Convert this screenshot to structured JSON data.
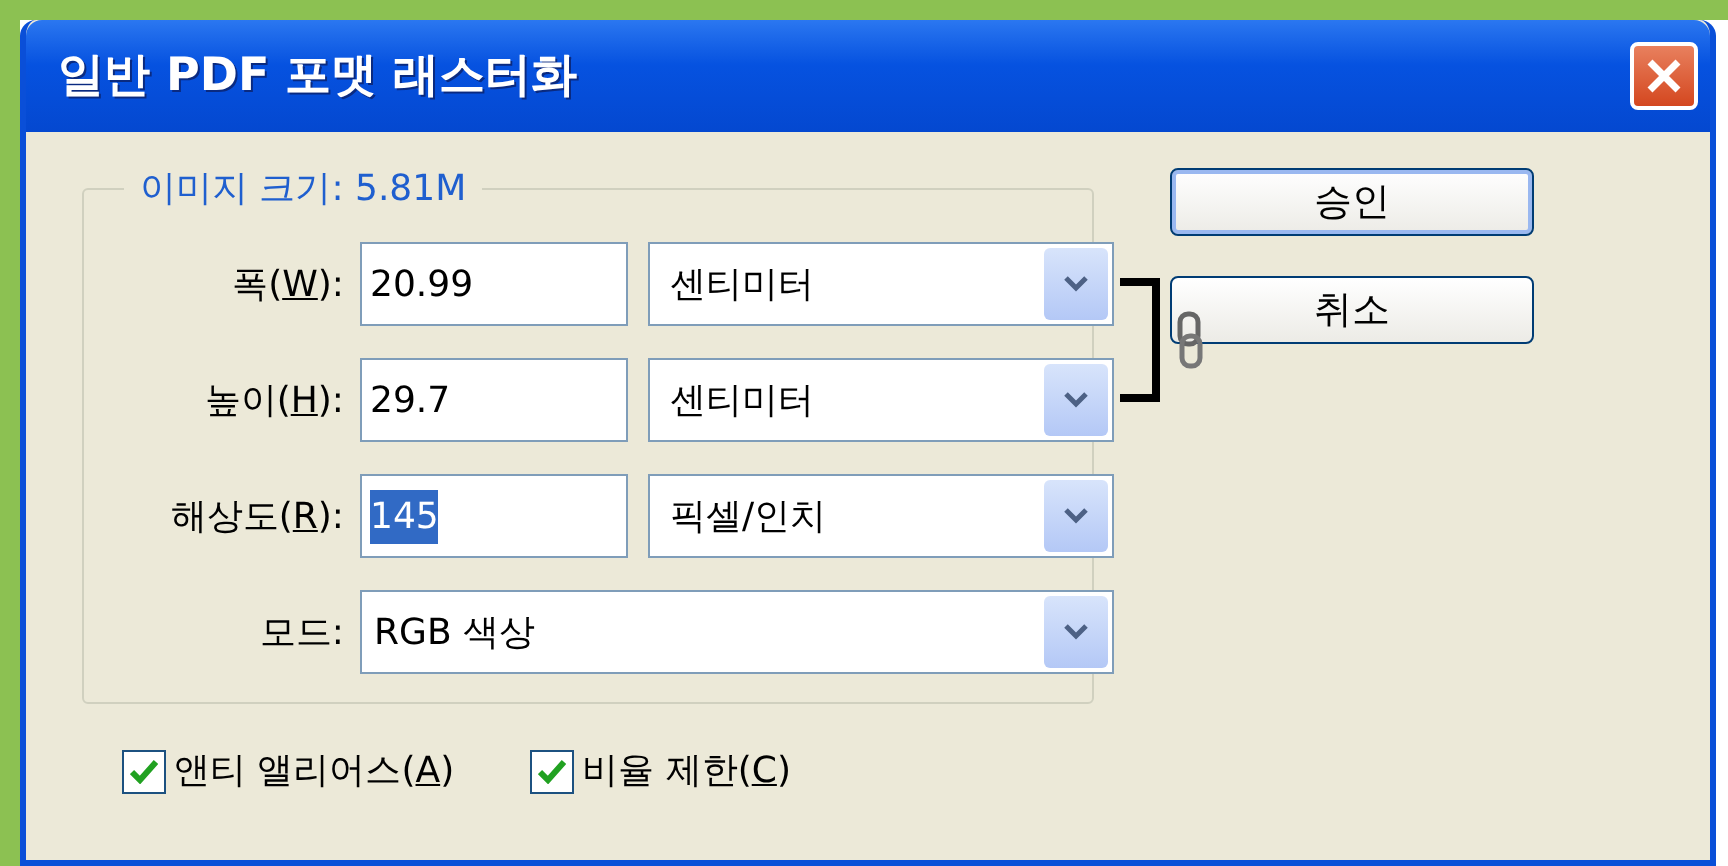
{
  "window": {
    "title": "일반 PDF 포맷 래스터화"
  },
  "image_size": {
    "legend": "이미지 크기: 5.81M"
  },
  "fields": [
    {
      "kind": "unit",
      "label_before": "폭(",
      "access_key": "W",
      "label_after": "):",
      "value": "20.99",
      "text_selected": false,
      "unit": "센티미터"
    },
    {
      "kind": "unit",
      "label_before": "높이(",
      "access_key": "H",
      "label_after": "):",
      "value": "29.7",
      "text_selected": false,
      "unit": "센티미터"
    },
    {
      "kind": "unit",
      "label_before": "해상도(",
      "access_key": "R",
      "label_after": "):",
      "value": "145",
      "text_selected": true,
      "unit": "픽셀/인치"
    },
    {
      "kind": "select",
      "label_before": "모드:",
      "value": "RGB 색상"
    }
  ],
  "buttons": [
    {
      "label": "승인",
      "default": true
    },
    {
      "label": "취소",
      "default": false
    }
  ],
  "options": [
    {
      "label_before": "앤티 앨리어스(",
      "access_key": "A",
      "label_after": ")",
      "checked": true
    },
    {
      "label_before": "비율 제한(",
      "access_key": "C",
      "label_after": ")",
      "checked": true
    }
  ]
}
